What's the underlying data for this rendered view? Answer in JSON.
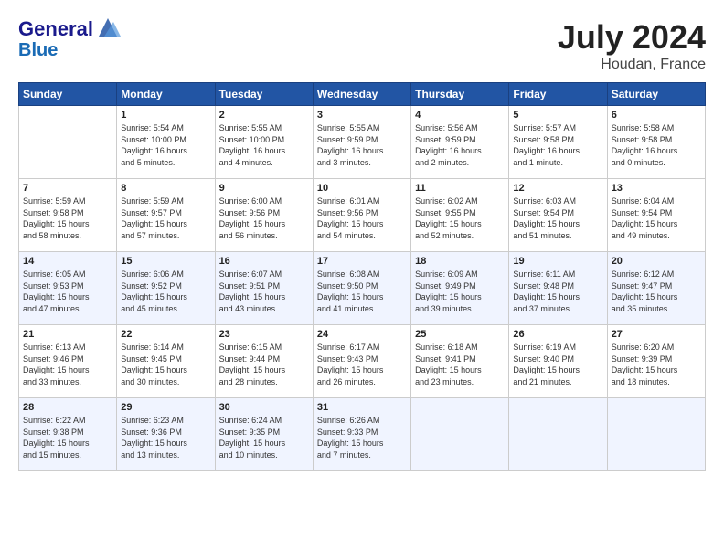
{
  "header": {
    "logo_line1": "General",
    "logo_line2": "Blue",
    "month_year": "July 2024",
    "location": "Houdan, France"
  },
  "days_of_week": [
    "Sunday",
    "Monday",
    "Tuesday",
    "Wednesday",
    "Thursday",
    "Friday",
    "Saturday"
  ],
  "weeks": [
    [
      {
        "num": "",
        "detail": ""
      },
      {
        "num": "1",
        "detail": "Sunrise: 5:54 AM\nSunset: 10:00 PM\nDaylight: 16 hours\nand 5 minutes."
      },
      {
        "num": "2",
        "detail": "Sunrise: 5:55 AM\nSunset: 10:00 PM\nDaylight: 16 hours\nand 4 minutes."
      },
      {
        "num": "3",
        "detail": "Sunrise: 5:55 AM\nSunset: 9:59 PM\nDaylight: 16 hours\nand 3 minutes."
      },
      {
        "num": "4",
        "detail": "Sunrise: 5:56 AM\nSunset: 9:59 PM\nDaylight: 16 hours\nand 2 minutes."
      },
      {
        "num": "5",
        "detail": "Sunrise: 5:57 AM\nSunset: 9:58 PM\nDaylight: 16 hours\nand 1 minute."
      },
      {
        "num": "6",
        "detail": "Sunrise: 5:58 AM\nSunset: 9:58 PM\nDaylight: 16 hours\nand 0 minutes."
      }
    ],
    [
      {
        "num": "7",
        "detail": "Sunrise: 5:59 AM\nSunset: 9:58 PM\nDaylight: 15 hours\nand 58 minutes."
      },
      {
        "num": "8",
        "detail": "Sunrise: 5:59 AM\nSunset: 9:57 PM\nDaylight: 15 hours\nand 57 minutes."
      },
      {
        "num": "9",
        "detail": "Sunrise: 6:00 AM\nSunset: 9:56 PM\nDaylight: 15 hours\nand 56 minutes."
      },
      {
        "num": "10",
        "detail": "Sunrise: 6:01 AM\nSunset: 9:56 PM\nDaylight: 15 hours\nand 54 minutes."
      },
      {
        "num": "11",
        "detail": "Sunrise: 6:02 AM\nSunset: 9:55 PM\nDaylight: 15 hours\nand 52 minutes."
      },
      {
        "num": "12",
        "detail": "Sunrise: 6:03 AM\nSunset: 9:54 PM\nDaylight: 15 hours\nand 51 minutes."
      },
      {
        "num": "13",
        "detail": "Sunrise: 6:04 AM\nSunset: 9:54 PM\nDaylight: 15 hours\nand 49 minutes."
      }
    ],
    [
      {
        "num": "14",
        "detail": "Sunrise: 6:05 AM\nSunset: 9:53 PM\nDaylight: 15 hours\nand 47 minutes."
      },
      {
        "num": "15",
        "detail": "Sunrise: 6:06 AM\nSunset: 9:52 PM\nDaylight: 15 hours\nand 45 minutes."
      },
      {
        "num": "16",
        "detail": "Sunrise: 6:07 AM\nSunset: 9:51 PM\nDaylight: 15 hours\nand 43 minutes."
      },
      {
        "num": "17",
        "detail": "Sunrise: 6:08 AM\nSunset: 9:50 PM\nDaylight: 15 hours\nand 41 minutes."
      },
      {
        "num": "18",
        "detail": "Sunrise: 6:09 AM\nSunset: 9:49 PM\nDaylight: 15 hours\nand 39 minutes."
      },
      {
        "num": "19",
        "detail": "Sunrise: 6:11 AM\nSunset: 9:48 PM\nDaylight: 15 hours\nand 37 minutes."
      },
      {
        "num": "20",
        "detail": "Sunrise: 6:12 AM\nSunset: 9:47 PM\nDaylight: 15 hours\nand 35 minutes."
      }
    ],
    [
      {
        "num": "21",
        "detail": "Sunrise: 6:13 AM\nSunset: 9:46 PM\nDaylight: 15 hours\nand 33 minutes."
      },
      {
        "num": "22",
        "detail": "Sunrise: 6:14 AM\nSunset: 9:45 PM\nDaylight: 15 hours\nand 30 minutes."
      },
      {
        "num": "23",
        "detail": "Sunrise: 6:15 AM\nSunset: 9:44 PM\nDaylight: 15 hours\nand 28 minutes."
      },
      {
        "num": "24",
        "detail": "Sunrise: 6:17 AM\nSunset: 9:43 PM\nDaylight: 15 hours\nand 26 minutes."
      },
      {
        "num": "25",
        "detail": "Sunrise: 6:18 AM\nSunset: 9:41 PM\nDaylight: 15 hours\nand 23 minutes."
      },
      {
        "num": "26",
        "detail": "Sunrise: 6:19 AM\nSunset: 9:40 PM\nDaylight: 15 hours\nand 21 minutes."
      },
      {
        "num": "27",
        "detail": "Sunrise: 6:20 AM\nSunset: 9:39 PM\nDaylight: 15 hours\nand 18 minutes."
      }
    ],
    [
      {
        "num": "28",
        "detail": "Sunrise: 6:22 AM\nSunset: 9:38 PM\nDaylight: 15 hours\nand 15 minutes."
      },
      {
        "num": "29",
        "detail": "Sunrise: 6:23 AM\nSunset: 9:36 PM\nDaylight: 15 hours\nand 13 minutes."
      },
      {
        "num": "30",
        "detail": "Sunrise: 6:24 AM\nSunset: 9:35 PM\nDaylight: 15 hours\nand 10 minutes."
      },
      {
        "num": "31",
        "detail": "Sunrise: 6:26 AM\nSunset: 9:33 PM\nDaylight: 15 hours\nand 7 minutes."
      },
      {
        "num": "",
        "detail": ""
      },
      {
        "num": "",
        "detail": ""
      },
      {
        "num": "",
        "detail": ""
      }
    ]
  ]
}
